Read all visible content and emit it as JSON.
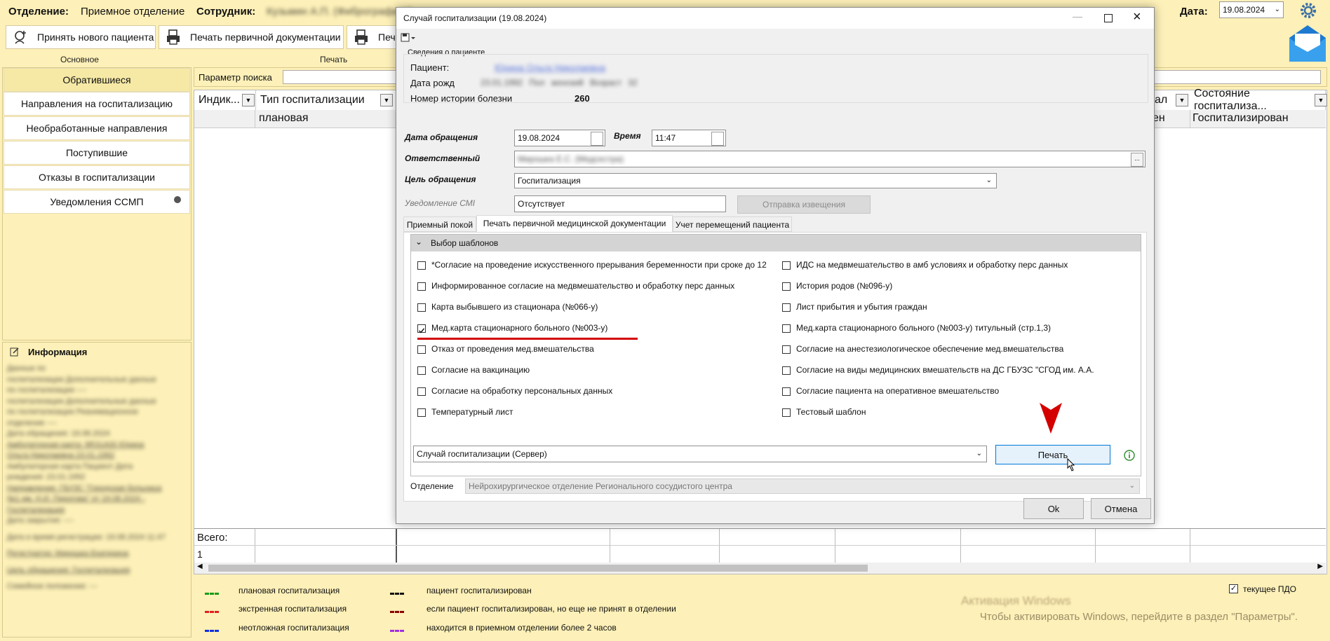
{
  "header": {
    "dept_label": "Отделение:",
    "dept_value": "Приемное отделение",
    "staff_label": "Сотрудник:",
    "staff_value": "Кузьмин А.П. (Фибрографист)",
    "date_label": "Дата:",
    "date_value": "19.08.2024"
  },
  "toolbar": {
    "new_patient": "Принять нового пациента",
    "print_primary": "Печать первичной документации",
    "print_cut": "Печ",
    "group_main": "Основное",
    "group_print": "Печать"
  },
  "nav": {
    "items": [
      "Обратившиеся",
      "Направления на госпитализацию",
      "Необработанные направления",
      "Поступившие",
      "Отказы в госпитализации",
      "Уведомления ССМП"
    ]
  },
  "search": {
    "label": "Параметр поиска"
  },
  "grid": {
    "col_indicator": "Индик...",
    "col_type": "Тип госпитализации",
    "col_al": "ал",
    "col_state": "Состояние госпитализа...",
    "row_type": "плановая",
    "row_en": "ен",
    "row_state": "Госпитализирован",
    "total_label": "Всего:",
    "total_value": "1"
  },
  "info": {
    "title": "Информация",
    "lines": [
      "Данные по",
      "госпитализации Дополнительные данные",
      "по госпитализации ----",
      "госпитализации Дополнительные данные",
      "по госпитализации Реанимационное",
      "отделение ----",
      "Дата обращения: 19.08.2024",
      "Амбулаторная карта: 9R31A00 Юрина",
      "Ольга Николаевна 23.01.1992",
      "Амбулаторная карта Пациент Дата",
      "рождения: 23.01.1992",
      "Направление: ГБУЗС \"Городская больница",
      "№1 им. Н.И. Пирогова\" от 19.08.2024 -",
      "Госпитализация",
      "Дата закрытия: ----",
      "Дата и время регистрации: 19.08.2024 11:47",
      "Регистратор: Мирошка Екатерина",
      "Цель обращения: Госпитализация",
      "Семейное положение: ---"
    ]
  },
  "legend": [
    {
      "text": "плановая госпитализация",
      "color": "#1a9b1a"
    },
    {
      "text": "экстренная госпитализация",
      "color": "#e02020"
    },
    {
      "text": "неотложная госпитализация",
      "color": "#1030e0"
    },
    {
      "text": "пациент госпитализирован",
      "color": "#111111"
    },
    {
      "text": "если пациент госпитализирован, но еще не принят в  отделении",
      "color": "#8b0000"
    },
    {
      "text": "находится в приемном отделении более 2 часов",
      "color": "#a030e0"
    }
  ],
  "current_pdo": "текущее ПДО",
  "watermark": {
    "line1": "Активация Windows",
    "line2": "Чтобы активировать Windows, перейдите в раздел \"Параметры\"."
  },
  "dialog": {
    "title": "Случай госпитализации (19.08.2024)",
    "patient_section": "Сведения о пациенте",
    "patient_label": "Пациент:",
    "patient_value": "Юрина Ольга Николаевна",
    "birth_label": "Дата рожд",
    "birth_value": "23.01.1992   Пол   женский   Возраст   32",
    "history_label": "Номер истории болезни",
    "history_value": "260",
    "date_label": "Дата обращения",
    "date_value": "19.08.2024",
    "time_label": "Время",
    "time_value": "11:47",
    "resp_label": "Ответственный",
    "resp_value": "Мирошка Е.С. (Медсестра)",
    "goal_label": "Цель обращения",
    "goal_value": "Госпитализация",
    "notify_label": "Уведомление СМI",
    "notify_value": "Отсутствует",
    "send_btn": "Отправка извещения",
    "tabs": [
      "Приемный покой",
      "Печать первичной медицинской документации",
      "Учет перемещений пациента"
    ],
    "templates_header": "Выбор шаблонов",
    "left_templates": [
      {
        "label": "*Согласие на проведение искусственного прерывания беременности при сроке до 12",
        "checked": false
      },
      {
        "label": "Информированное согласие на медвмешательство и обработку перс данных",
        "checked": false
      },
      {
        "label": "Карта выбывшего из стационара (№066-у)",
        "checked": false
      },
      {
        "label": "Мед.карта стационарного больного (№003-у)",
        "checked": true
      },
      {
        "label": "Отказ от проведения мед.вмешательства",
        "checked": false
      },
      {
        "label": "Согласие на вакцинацию",
        "checked": false
      },
      {
        "label": "Согласие на обработку персональных данных",
        "checked": false
      },
      {
        "label": "Температурный лист",
        "checked": false
      }
    ],
    "right_templates": [
      {
        "label": "ИДС на медвмешательство в амб условиях и обработку перс данных",
        "checked": false
      },
      {
        "label": "История родов (№096-у)",
        "checked": false
      },
      {
        "label": "Лист прибытия и убытия граждан",
        "checked": false
      },
      {
        "label": "Мед.карта стационарного больного (№003-у) титульный (стр.1,3)",
        "checked": false
      },
      {
        "label": "Согласие на анестезиологическое обеспечение мед.вмешательства",
        "checked": false
      },
      {
        "label": "Согласие на виды медицинских вмешательств на ДС ГБУЗС \"СГОД им. А.А.",
        "checked": false
      },
      {
        "label": "Согласие пациента на оперативное вмешательство",
        "checked": false
      },
      {
        "label": "Тестовый шаблон",
        "checked": false
      }
    ],
    "source_value": "Случай госпитализации (Сервер)",
    "print_btn": "Печать",
    "dept_label": "Отделение",
    "dept_value": "Нейрохирургическое отделение Регионального сосудистого центра",
    "ok_btn": "Ok",
    "cancel_btn": "Отмена"
  },
  "colors": {
    "accent_red": "#d40000",
    "bg": "#fdf0b8"
  }
}
